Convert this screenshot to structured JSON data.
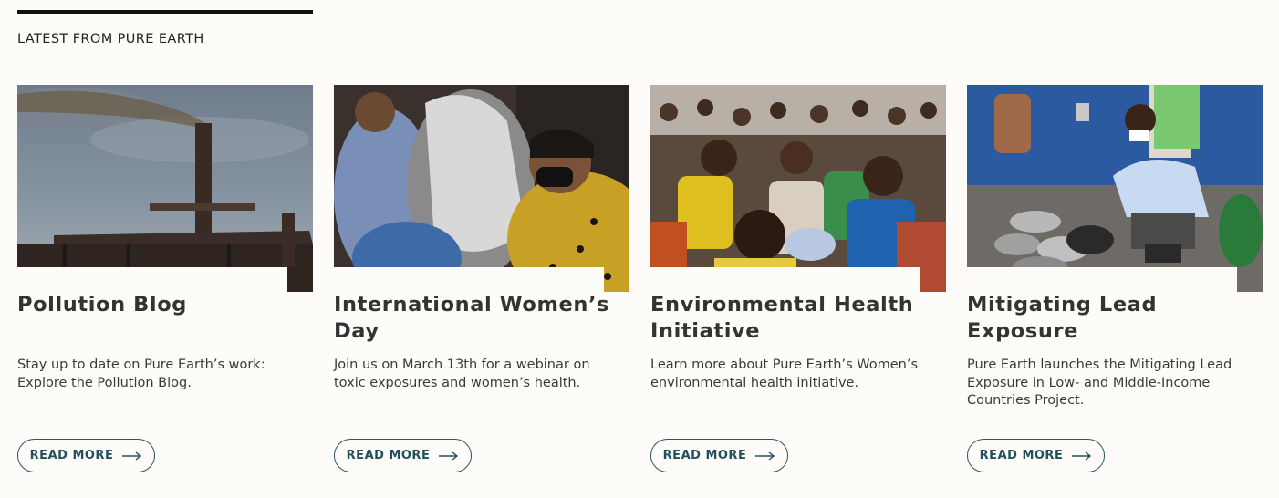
{
  "section": {
    "title": "LATEST FROM PURE EARTH"
  },
  "cards": [
    {
      "image": "factory-smokestack-image",
      "title": "Pollution Blog",
      "description": "Stay up to date on Pure Earth’s work: Explore the Pollution Blog.",
      "button_label": "READ MORE"
    },
    {
      "image": "women-gathering-image",
      "title": "International Women’s Day",
      "description": "Join us on March 13th for a webinar on toxic exposures and women’s health.",
      "button_label": "READ MORE"
    },
    {
      "image": "community-meeting-image",
      "title": "Environmental Health Initiative",
      "description": "Learn more about Pure Earth’s Women’s environmental health initiative.",
      "button_label": "READ MORE"
    },
    {
      "image": "cookware-testing-image",
      "title": "Mitigating Lead Exposure",
      "description": "Pure Earth launches the Mitigating Lead Exposure in Low- and Middle-Income Countries Project.",
      "button_label": "READ MORE"
    }
  ],
  "colors": {
    "background": "#fdfcf8",
    "button_border": "#2b5563",
    "button_text": "#23505e",
    "rule": "#111111"
  },
  "icons": {
    "button_arrow": "long-arrow-right-icon"
  }
}
